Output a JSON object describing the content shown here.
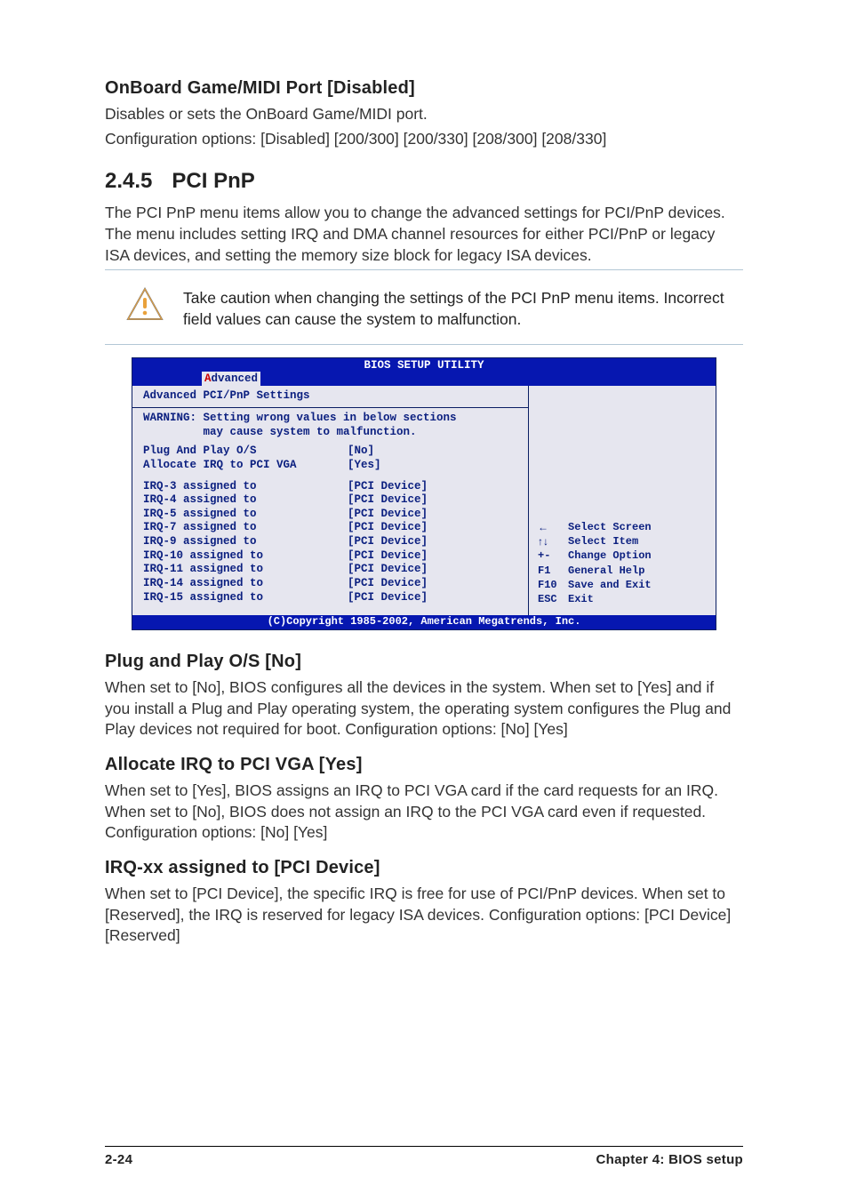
{
  "settings": {
    "onboard": {
      "title": "OnBoard Game/MIDI Port [Disabled]",
      "line1": "Disables or sets the OnBoard Game/MIDI port.",
      "line2": "Configuration options: [Disabled] [200/300] [200/330] [208/300] [208/330]"
    },
    "pcipnp_section": {
      "number": "2.4.5",
      "title": "PCI PnP",
      "body": "The PCI PnP menu items allow you to change the advanced settings for PCI/PnP devices. The menu includes setting IRQ and DMA channel resources for either PCI/PnP or legacy ISA devices, and setting the memory size block for legacy ISA devices."
    },
    "caution": "Take caution when changing the settings of the PCI PnP menu items. Incorrect field values can cause the system to malfunction.",
    "plug_os": {
      "title": "Plug and Play O/S [No]",
      "body": "When set to [No], BIOS configures all the devices in the system. When set to [Yes] and if you install a Plug and Play operating system, the operating system configures the Plug and Play devices not required for boot. Configuration options: [No] [Yes]"
    },
    "alloc_irq": {
      "title": "Allocate IRQ to PCI VGA [Yes]",
      "body": "When set to [Yes], BIOS assigns an IRQ to PCI VGA card if the card requests for an IRQ. When set to [No], BIOS does not assign an IRQ to the PCI VGA card even if requested. Configuration options: [No] [Yes]"
    },
    "irq_xx": {
      "title": "IRQ-xx assigned to [PCI Device]",
      "body": "When set to [PCI Device], the specific IRQ is free for use of PCI/PnP devices. When set to [Reserved], the IRQ is reserved for legacy ISA devices. Configuration options: [PCI Device] [Reserved]"
    }
  },
  "bios": {
    "header_title": "BIOS SETUP UTILITY",
    "tab_hot": "A",
    "tab_rest": "dvanced",
    "subtitle": "Advanced PCI/PnP Settings",
    "warning": "WARNING: Setting wrong values in below sections\n         may cause system to malfunction.",
    "rows_a": [
      {
        "label": "Plug And Play O/S",
        "value": "[No]"
      },
      {
        "label": "Allocate IRQ to PCI VGA",
        "value": "[Yes]"
      }
    ],
    "rows_b": [
      {
        "label": "IRQ-3 assigned to",
        "value": "[PCI Device]"
      },
      {
        "label": "IRQ-4 assigned to",
        "value": "[PCI Device]"
      },
      {
        "label": "IRQ-5 assigned to",
        "value": "[PCI Device]"
      },
      {
        "label": "IRQ-7 assigned to",
        "value": "[PCI Device]"
      },
      {
        "label": "IRQ-9 assigned to",
        "value": "[PCI Device]"
      },
      {
        "label": "IRQ-10 assigned to",
        "value": "[PCI Device]"
      },
      {
        "label": "IRQ-11 assigned to",
        "value": "[PCI Device]"
      },
      {
        "label": "IRQ-14 assigned to",
        "value": "[PCI Device]"
      },
      {
        "label": "IRQ-15 assigned to",
        "value": "[PCI Device]"
      }
    ],
    "help": [
      {
        "key": "←",
        "text": "Select Screen"
      },
      {
        "key": "↑↓",
        "text": "Select Item"
      },
      {
        "key": "+-",
        "text": "Change Option"
      },
      {
        "key": "F1",
        "text": "General Help"
      },
      {
        "key": "F10",
        "text": "Save and Exit"
      },
      {
        "key": "ESC",
        "text": "Exit"
      }
    ],
    "footer": "(C)Copyright 1985-2002, American Megatrends, Inc."
  },
  "page_footer": {
    "left": "2-24",
    "right": "Chapter 4: BIOS setup"
  }
}
